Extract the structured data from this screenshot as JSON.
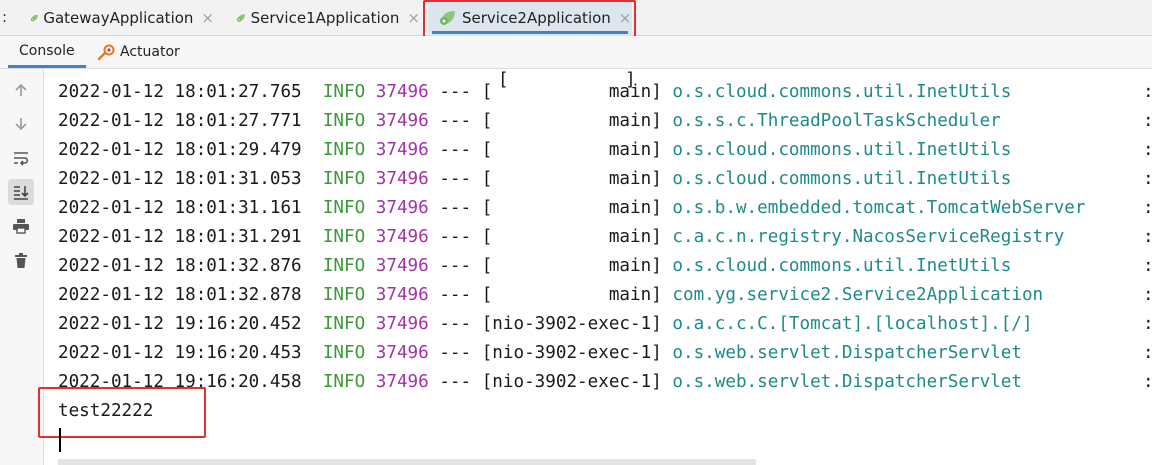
{
  "run_tabs": {
    "lead": ":",
    "tabs": [
      {
        "label": "GatewayApplication",
        "close": "×"
      },
      {
        "label": "Service1Application",
        "close": "×"
      },
      {
        "label": "Service2Application",
        "close": "×",
        "active": true
      }
    ]
  },
  "sub_tabs": [
    {
      "label": "Console",
      "active": true
    },
    {
      "label": "Actuator",
      "icon": "actuator-icon"
    }
  ],
  "toolbar": [
    {
      "icon": "scroll-up-arrow-icon"
    },
    {
      "icon": "scroll-down-arrow-icon"
    },
    {
      "icon": "soft-wrap-icon"
    },
    {
      "icon": "scroll-to-end-icon",
      "active": true
    },
    {
      "icon": "print-icon"
    },
    {
      "icon": "trash-icon"
    }
  ],
  "console": {
    "lines": [
      {
        "ts": "2022-01-12 18:01:27.765",
        "level": "INFO",
        "pid": "37496",
        "sep": "---",
        "thread": "[           main]",
        "logger": "o.s.cloud.commons.util.InetUtils",
        "tail": ":"
      },
      {
        "ts": "2022-01-12 18:01:27.771",
        "level": "INFO",
        "pid": "37496",
        "sep": "---",
        "thread": "[           main]",
        "logger": "o.s.s.c.ThreadPoolTaskScheduler",
        "tail": ":"
      },
      {
        "ts": "2022-01-12 18:01:29.479",
        "level": "INFO",
        "pid": "37496",
        "sep": "---",
        "thread": "[           main]",
        "logger": "o.s.cloud.commons.util.InetUtils",
        "tail": ":"
      },
      {
        "ts": "2022-01-12 18:01:31.053",
        "level": "INFO",
        "pid": "37496",
        "sep": "---",
        "thread": "[           main]",
        "logger": "o.s.cloud.commons.util.InetUtils",
        "tail": ":"
      },
      {
        "ts": "2022-01-12 18:01:31.161",
        "level": "INFO",
        "pid": "37496",
        "sep": "---",
        "thread": "[           main]",
        "logger": "o.s.b.w.embedded.tomcat.TomcatWebServer",
        "tail": ":"
      },
      {
        "ts": "2022-01-12 18:01:31.291",
        "level": "INFO",
        "pid": "37496",
        "sep": "---",
        "thread": "[           main]",
        "logger": "c.a.c.n.registry.NacosServiceRegistry",
        "tail": ":"
      },
      {
        "ts": "2022-01-12 18:01:32.876",
        "level": "INFO",
        "pid": "37496",
        "sep": "---",
        "thread": "[           main]",
        "logger": "o.s.cloud.commons.util.InetUtils",
        "tail": ":"
      },
      {
        "ts": "2022-01-12 18:01:32.878",
        "level": "INFO",
        "pid": "37496",
        "sep": "---",
        "thread": "[           main]",
        "logger": "com.yg.service2.Service2Application",
        "tail": ":"
      },
      {
        "ts": "2022-01-12 19:16:20.452",
        "level": "INFO",
        "pid": "37496",
        "sep": "---",
        "thread": "[nio-3902-exec-1]",
        "logger": "o.a.c.c.C.[Tomcat].[localhost].[/]",
        "tail": ":"
      },
      {
        "ts": "2022-01-12 19:16:20.453",
        "level": "INFO",
        "pid": "37496",
        "sep": "---",
        "thread": "[nio-3902-exec-1]",
        "logger": "o.s.web.servlet.DispatcherServlet",
        "tail": ":"
      },
      {
        "ts": "2022-01-12 19:16:20.458",
        "level": "INFO",
        "pid": "37496",
        "sep": "---",
        "thread": "[nio-3902-exec-1]",
        "logger": "o.s.web.servlet.DispatcherServlet",
        "tail": ":"
      }
    ],
    "output": "test22222"
  },
  "colors": {
    "info": "#3b9a36",
    "pid": "#a231a8",
    "logger": "#1e8a8a",
    "highlight": "#e03030",
    "active_underline": "#4083c9"
  }
}
